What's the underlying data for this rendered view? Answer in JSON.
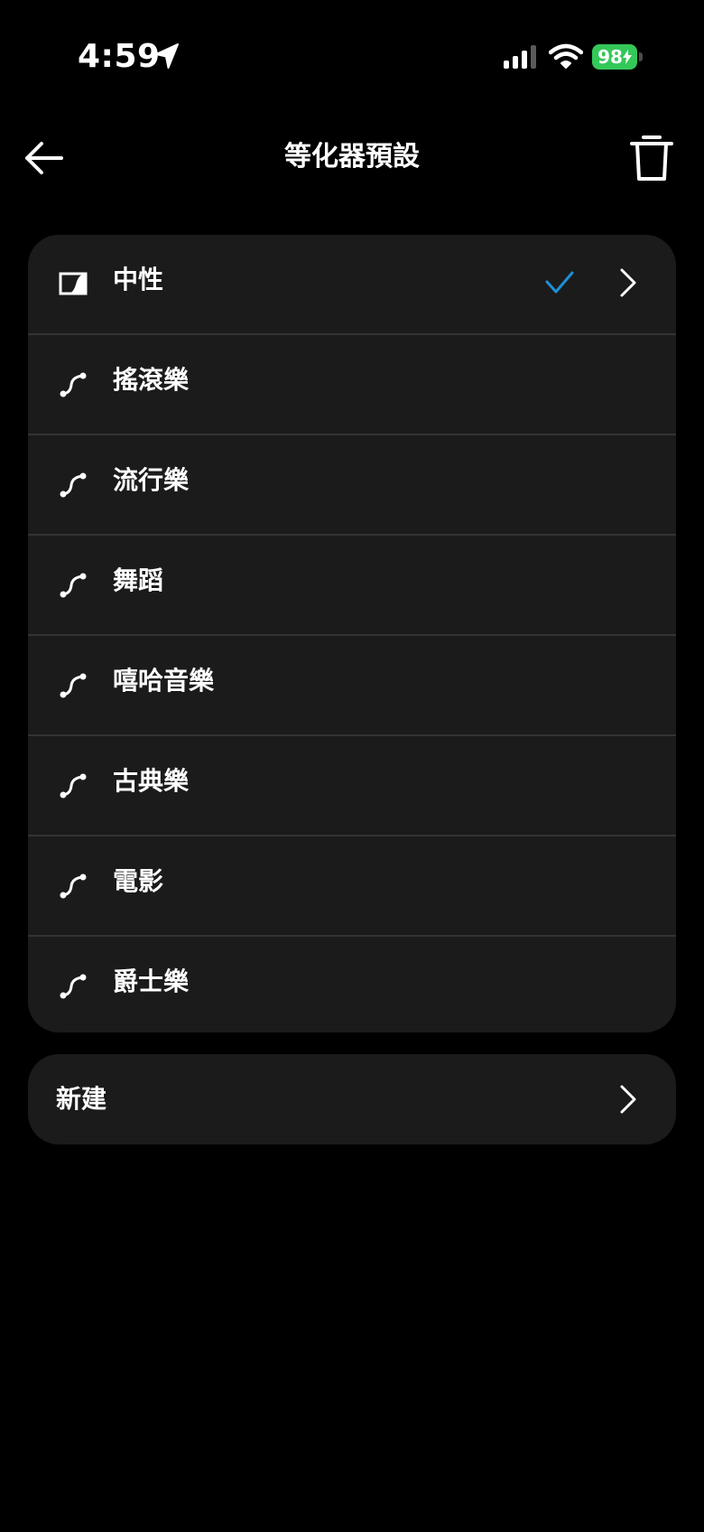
{
  "status_bar": {
    "time": "4:59",
    "battery_percent": "98",
    "icons": [
      "location-arrow-icon",
      "cellular-signal-icon",
      "wifi-icon",
      "battery-charging-icon"
    ],
    "battery_color": "#34c759"
  },
  "nav": {
    "title": "等化器預設",
    "back_icon": "arrow-left-icon",
    "delete_icon": "trash-icon"
  },
  "presets": [
    {
      "label": "中性",
      "icon": "neutral-eq-icon",
      "selected": true
    },
    {
      "label": "搖滾樂",
      "icon": "eq-curve-icon",
      "selected": false
    },
    {
      "label": "流行樂",
      "icon": "eq-curve-icon",
      "selected": false
    },
    {
      "label": "舞蹈",
      "icon": "eq-curve-icon",
      "selected": false
    },
    {
      "label": "嘻哈音樂",
      "icon": "eq-curve-icon",
      "selected": false
    },
    {
      "label": "古典樂",
      "icon": "eq-curve-icon",
      "selected": false
    },
    {
      "label": "電影",
      "icon": "eq-curve-icon",
      "selected": false
    },
    {
      "label": "爵士樂",
      "icon": "eq-curve-icon",
      "selected": false
    }
  ],
  "new_preset": {
    "label": "新建"
  },
  "colors": {
    "background": "#000000",
    "card": "#1b1b1b",
    "divider": "#333333",
    "accent_check": "#1e90d6"
  }
}
